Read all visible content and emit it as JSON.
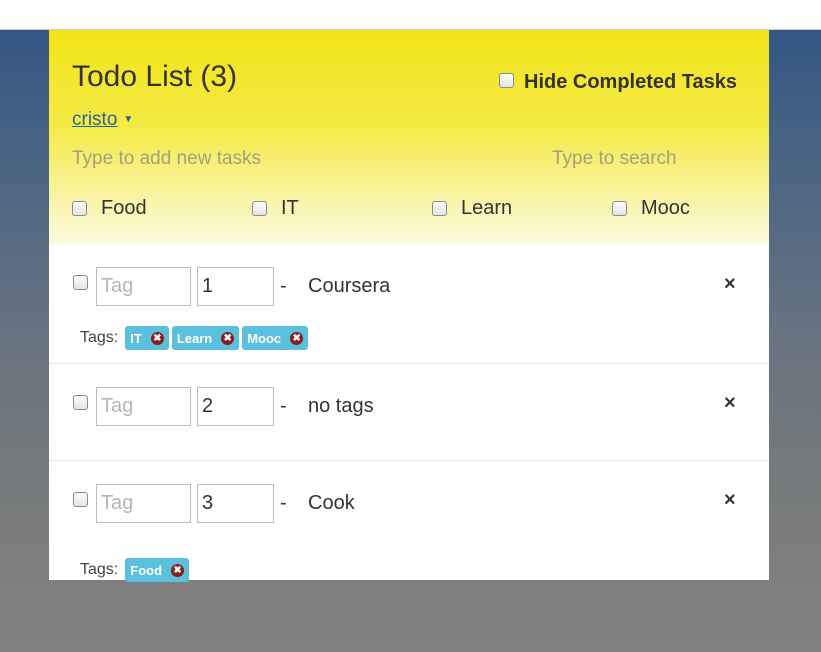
{
  "header": {
    "title": "Todo List (3)",
    "hide_completed_label": "Hide Completed Tasks",
    "user": "cristo",
    "new_task_placeholder": "Type to add new tasks",
    "search_placeholder": "Type to search",
    "tag_filters": [
      "Food",
      "IT",
      "Learn",
      "Mooc"
    ]
  },
  "tasks": [
    {
      "tag_placeholder": "Tag",
      "number": "1",
      "dash": "-",
      "text": "Coursera",
      "delete": "×",
      "tags_label": "Tags:",
      "tags": [
        "IT",
        "Learn",
        "Mooc"
      ]
    },
    {
      "tag_placeholder": "Tag",
      "number": "2",
      "dash": "-",
      "text": "no tags",
      "delete": "×",
      "tags_label": "",
      "tags": []
    },
    {
      "tag_placeholder": "Tag",
      "number": "3",
      "dash": "-",
      "text": "Cook",
      "delete": "×",
      "tags_label": "Tags:",
      "tags": [
        "Food"
      ]
    }
  ],
  "colors": {
    "header_yellow": "#f2e419",
    "tag_badge": "#5bc0de",
    "tag_remove": "#8b1c1c",
    "link": "#2a6496"
  },
  "icons": {
    "user_caret": "caret-down-icon",
    "tag_remove": "remove-circle-icon",
    "task_delete": "close-icon"
  }
}
